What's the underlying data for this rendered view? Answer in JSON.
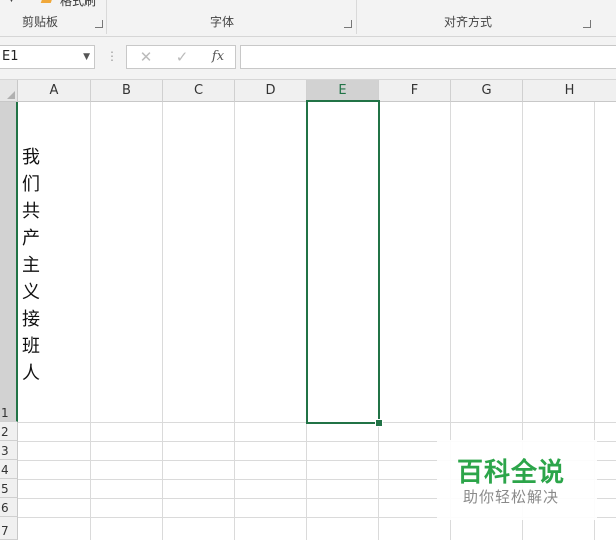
{
  "ribbon": {
    "format_painter_label": "格式刷",
    "clipboard_label": "剪贴板",
    "font_label": "字体",
    "alignment_label": "对齐方式"
  },
  "formula_bar": {
    "name_box_value": "E1",
    "cancel_symbol": "✕",
    "enter_symbol": "✓",
    "fx_symbol": "fx",
    "formula_value": ""
  },
  "sheet": {
    "columns": [
      "A",
      "B",
      "C",
      "D",
      "E",
      "F",
      "G",
      "H"
    ],
    "selected_column": "E",
    "rows": [
      "1",
      "2",
      "3",
      "4",
      "5",
      "6",
      "7"
    ],
    "selected_cell": "E1",
    "a1_chars": [
      "我",
      "们",
      "共",
      "产",
      "主",
      "义",
      "接",
      "班",
      "人"
    ]
  },
  "watermark": {
    "title": "百科全说",
    "subtitle": "助你轻松解决"
  },
  "colors": {
    "accent": "#217346",
    "watermark_green": "#2ca54a"
  }
}
